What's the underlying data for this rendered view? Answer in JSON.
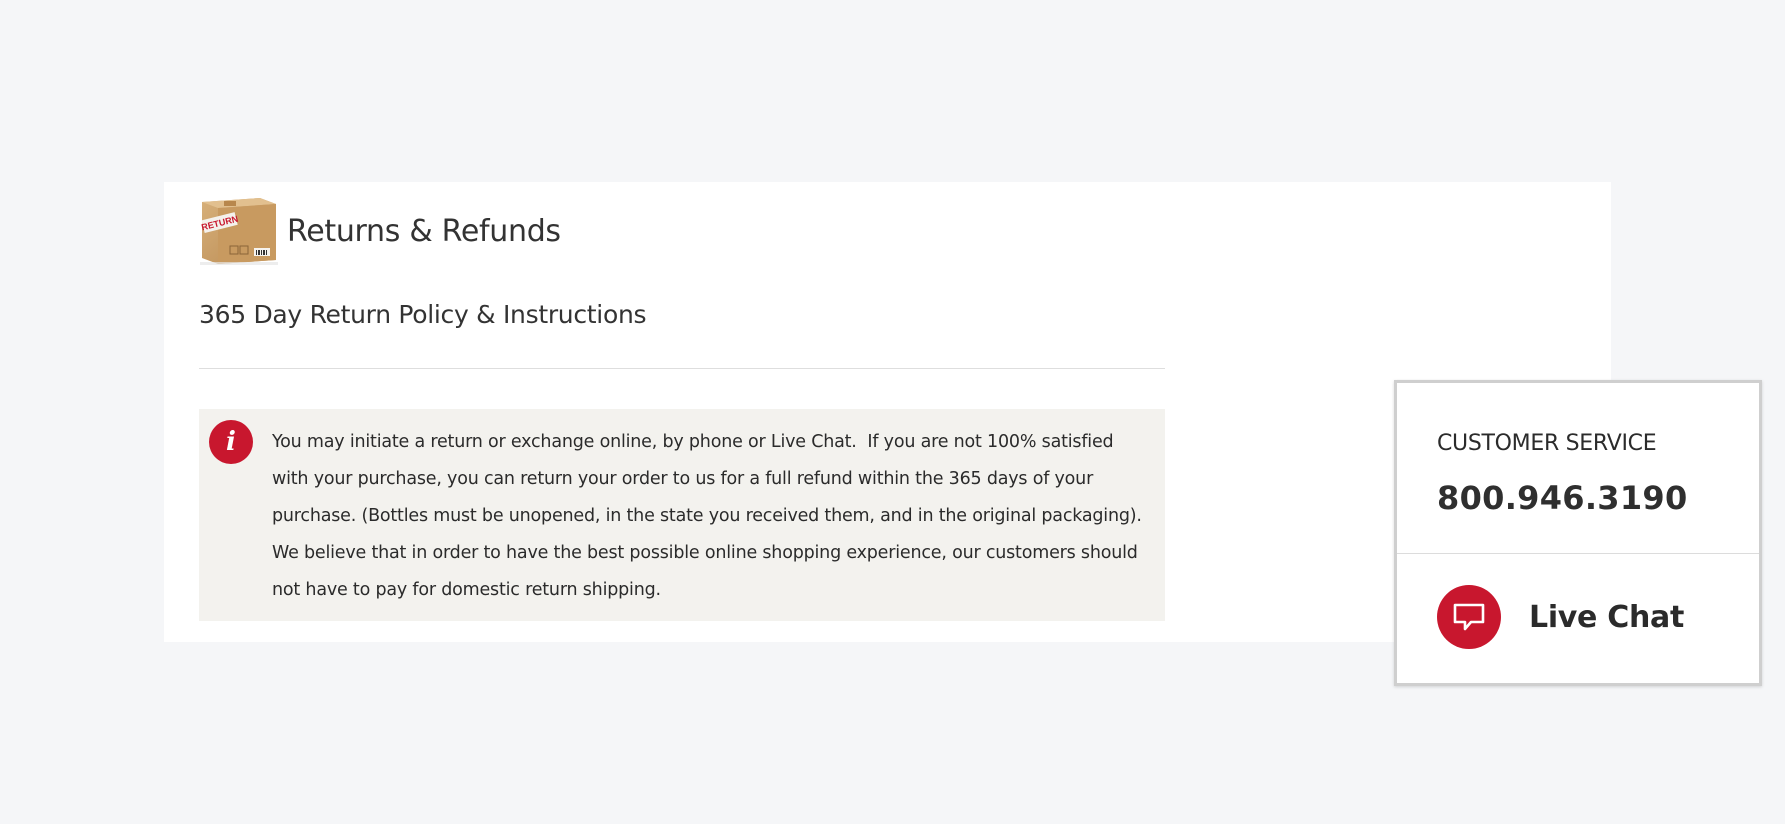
{
  "header": {
    "title": "Returns & Refunds",
    "box_label": "RETURN",
    "subtitle": "365 Day Return Policy & Instructions"
  },
  "notice": {
    "icon": "info-icon",
    "text": "You may initiate a return or exchange online, by phone or Live Chat.  If you are not 100% satisfied with your purchase, you can return your order to us for a full refund within the 365 days of your purchase. (Bottles must be unopened, in the state you received them, and in the original packaging). We believe that in order to have the best possible online shopping experience, our customers should not have to pay for domestic return shipping."
  },
  "customer_service": {
    "label": "CUSTOMER SERVICE",
    "phone": "800.946.3190",
    "chat_label": "Live Chat",
    "chat_icon": "chat-bubble-icon"
  },
  "colors": {
    "accent": "#c8172e",
    "background": "#f5f6f8",
    "notice_bg": "#f3f2ee"
  }
}
